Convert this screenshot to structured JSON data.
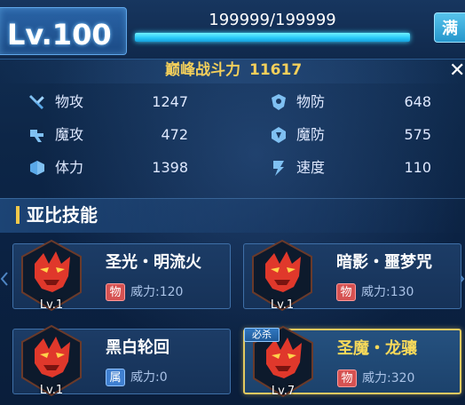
{
  "header": {
    "level": "Lv.100",
    "exp_text": "199999/199999",
    "exp_progress": 1.0,
    "max_button": "满"
  },
  "power": {
    "label": "巅峰战斗力",
    "value": "11617"
  },
  "stats": [
    {
      "label": "物攻",
      "value": "1247",
      "icon": "sword-icon"
    },
    {
      "label": "物防",
      "value": "648",
      "icon": "shield-icon"
    },
    {
      "label": "魔攻",
      "value": "472",
      "icon": "magic-attack-icon"
    },
    {
      "label": "魔防",
      "value": "575",
      "icon": "magic-defense-icon"
    },
    {
      "label": "体力",
      "value": "1398",
      "icon": "stamina-icon"
    },
    {
      "label": "速度",
      "value": "110",
      "icon": "speed-icon"
    }
  ],
  "skills_section": {
    "title": "亚比技能"
  },
  "skills": [
    {
      "name": "圣光・明流火",
      "level": "Lv.1",
      "type": "物",
      "power": "威力:120",
      "tag": ""
    },
    {
      "name": "暗影・噩梦咒",
      "level": "Lv.1",
      "type": "物",
      "power": "威力:130",
      "tag": ""
    },
    {
      "name": "黑白轮回",
      "level": "Lv.1",
      "type": "属",
      "power": "威力:0",
      "tag": ""
    },
    {
      "name": "圣魔・龙骧",
      "level": "Lv.7",
      "type": "物",
      "power": "威力:320",
      "tag": "必杀"
    }
  ],
  "colors": {
    "accent_gold": "#f3cf5b",
    "exp_bar": "#25c6f6",
    "physical_badge": "#d65252",
    "attribute_badge": "#3f7fd0"
  }
}
